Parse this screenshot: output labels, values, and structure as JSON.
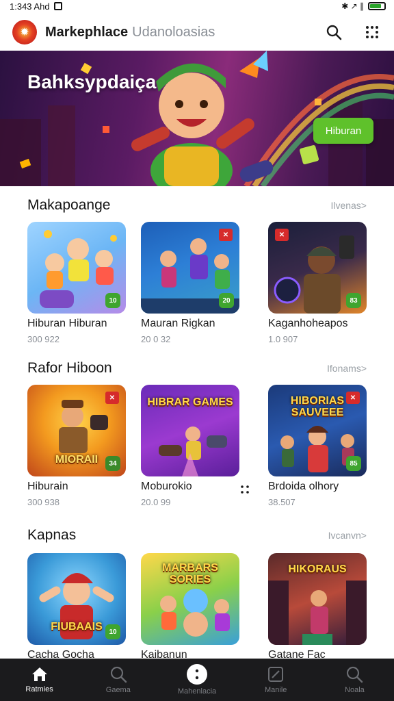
{
  "status_bar": {
    "time": "1:343 Ahd",
    "signal_text": "✱ ↗ ∥"
  },
  "app_bar": {
    "title": "Markephlace",
    "subtitle": "Udanoloasias",
    "logo_icon": "game-logo",
    "actions": [
      {
        "icon": "search-icon"
      },
      {
        "icon": "grid-dots-icon"
      }
    ]
  },
  "banner": {
    "title": "Bahksypdaiça",
    "button_label": "Hiburan"
  },
  "sections": [
    {
      "title": "Makapoange",
      "more_label": "Ilvenas>",
      "items": [
        {
          "name": "Hiburan Hiburan",
          "sub": "300 922",
          "badge": "10"
        },
        {
          "name": "Mauran Rigkan",
          "sub": "20 0 32",
          "badge": "20"
        },
        {
          "name": "Kaganhoheapos",
          "sub": "1.0 907",
          "badge": "83"
        }
      ]
    },
    {
      "title": "Rafor Hiboon",
      "more_label": "Ifonams>",
      "items": [
        {
          "name": "Hiburain",
          "sub": "300 938",
          "badge": "34",
          "art_text": "MIORAII"
        },
        {
          "name": "Moburokio",
          "sub": "20.0 99",
          "badge": "",
          "art_text": "HIBRAR GAMES"
        },
        {
          "name": "Brdoida olhory",
          "sub": "38.507",
          "badge": "85",
          "art_text": "HIBORIAS SAUVEEE"
        }
      ]
    },
    {
      "title": "Kapnas",
      "more_label": "Ivcanvn>",
      "items": [
        {
          "name": "Cacha Gocha",
          "sub": "",
          "badge": "10",
          "art_text": "FIUBAAIS"
        },
        {
          "name": "Kaibanun",
          "sub": "",
          "badge": "",
          "art_text": "MARBARS SORIES"
        },
        {
          "name": "Gatane Fac",
          "sub": "",
          "badge": "",
          "art_text": "HIKORAUS"
        }
      ]
    }
  ],
  "bottom_nav": [
    {
      "label": "Ratmies",
      "icon": "home-icon",
      "active": true
    },
    {
      "label": "Gaema",
      "icon": "search-icon",
      "active": false
    },
    {
      "label": "Mahenlacia",
      "icon": "more-icon",
      "active": false
    },
    {
      "label": "Manile",
      "icon": "edit-icon",
      "active": false
    },
    {
      "label": "Noala",
      "icon": "search-icon",
      "active": false
    }
  ],
  "colors": {
    "accent_green": "#5fc12b",
    "badge_red": "#d62b2b",
    "nav_bg": "#1b1b1d"
  }
}
